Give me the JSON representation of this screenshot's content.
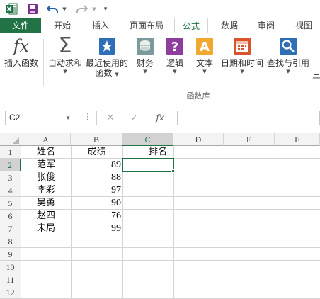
{
  "ribbon_tabs": [
    "文件",
    "开始",
    "插入",
    "页面布局",
    "公式",
    "数据",
    "审阅",
    "视图"
  ],
  "active_tab": "公式",
  "colors": {
    "accent": "#217346",
    "save_icon": "#7b2f8e",
    "undo_icon": "#1f5fa6"
  },
  "ribbon": {
    "insert_function": "插入函数",
    "autosum": "自动求和",
    "recent_line1": "最近使用的",
    "recent_line2": "函数",
    "financial": "财务",
    "logical": "逻辑",
    "text": "文本",
    "datetime": "日期和时间",
    "lookup": "查找与引用",
    "overflow": "三",
    "group_label": "函数库"
  },
  "formula_bar": {
    "name_box": "C2",
    "fx_label": "fx",
    "formula": ""
  },
  "sheet": {
    "columns": [
      "A",
      "B",
      "C",
      "D",
      "E",
      "F"
    ],
    "selected_column": "C",
    "row_numbers": [
      "1",
      "2",
      "3",
      "4",
      "5",
      "6",
      "7",
      "8",
      "9",
      "10",
      "11",
      "12"
    ],
    "selected_row": "2",
    "header_row": {
      "a": "姓名",
      "b": "成绩",
      "c": "排名"
    },
    "rows": [
      {
        "name": "范军",
        "score": "89"
      },
      {
        "name": "张俊",
        "score": "88"
      },
      {
        "name": "李彩",
        "score": "97"
      },
      {
        "name": "吴勇",
        "score": "90"
      },
      {
        "name": "赵四",
        "score": "76"
      },
      {
        "name": "宋局",
        "score": "99"
      }
    ]
  }
}
